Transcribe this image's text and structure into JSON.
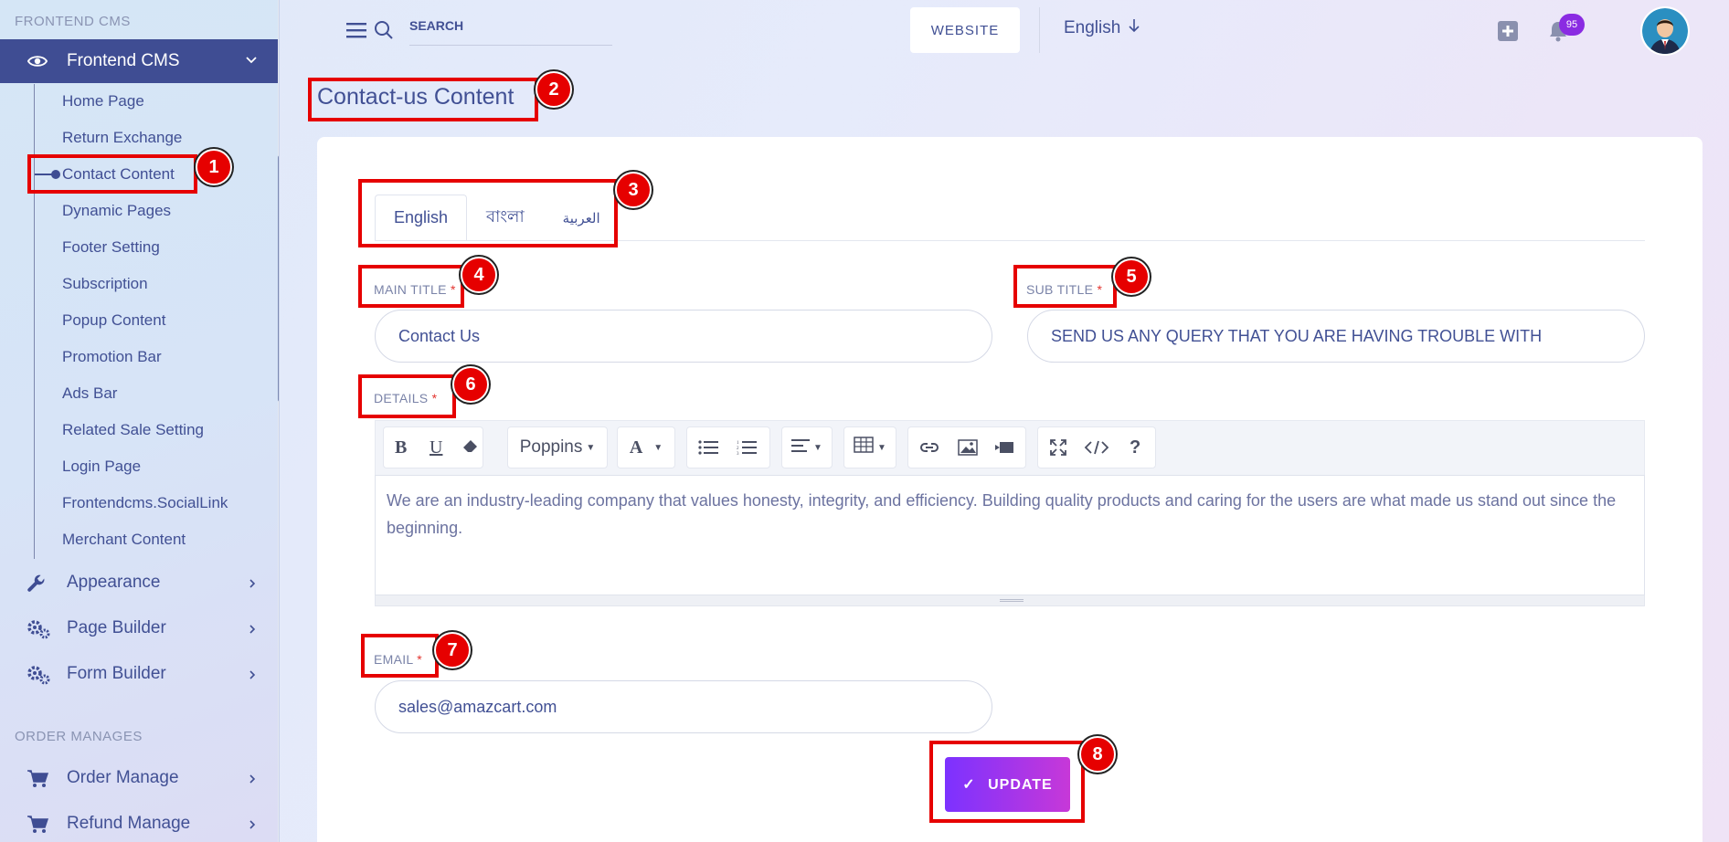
{
  "sidebar": {
    "section_frontend": "FRONTEND CMS",
    "active_parent": "Frontend CMS",
    "sub_items": [
      "Home Page",
      "Return Exchange",
      "Contact Content",
      "Dynamic Pages",
      "Footer Setting",
      "Subscription",
      "Popup Content",
      "Promotion Bar",
      "Ads Bar",
      "Related Sale Setting",
      "Login Page",
      "Frontendcms.SocialLink",
      "Merchant Content"
    ],
    "active_sub": "Contact Content",
    "menu_items": [
      "Appearance",
      "Page Builder",
      "Form Builder"
    ],
    "section_orders": "ORDER MANAGES",
    "order_items": [
      "Order Manage",
      "Refund Manage"
    ]
  },
  "header": {
    "search_placeholder": "SEARCH",
    "website_label": "WEBSITE",
    "language": "English",
    "notification_count": "95"
  },
  "page": {
    "title": "Contact-us Content"
  },
  "tabs": [
    "English",
    "বাংলা",
    "العربية"
  ],
  "form": {
    "main_title_label": "MAIN TITLE",
    "main_title_value": "Contact Us",
    "sub_title_label": "SUB TITLE",
    "sub_title_value": "SEND US ANY QUERY THAT YOU ARE HAVING TROUBLE WITH",
    "details_label": "DETAILS",
    "details_value": "We are an industry-leading company that values honesty, integrity, and efficiency. Building quality products and caring for the users are what made us stand out since the beginning.",
    "email_label": "EMAIL",
    "email_value": "sales@amazcart.com",
    "required_mark": "*",
    "update_label": "UPDATE",
    "update_check": "✓"
  },
  "editor_toolbar": {
    "font_name": "Poppins"
  },
  "annotations": [
    "1",
    "2",
    "3",
    "4",
    "5",
    "6",
    "7",
    "8"
  ],
  "colors": {
    "primary": "#415094",
    "active_bg": "#3f4d93",
    "annotation": "#e60000",
    "button_start": "#7c32ff",
    "button_end": "#c738d8",
    "badge": "#8a2be2"
  }
}
